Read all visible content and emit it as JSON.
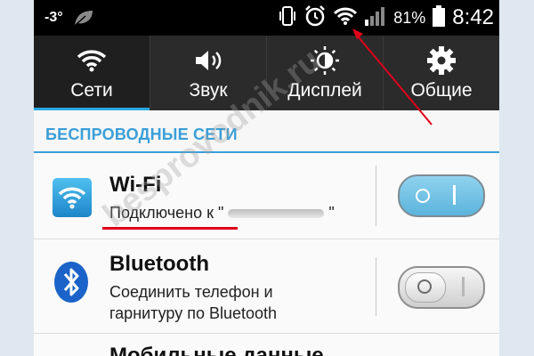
{
  "status_bar": {
    "signal": "-3°",
    "battery_percent": "81%",
    "time": "8:42",
    "icons": [
      "leaf-icon",
      "vibrate-icon",
      "alarm-icon",
      "wifi-icon",
      "signal-bars-icon",
      "battery-icon"
    ]
  },
  "tabs": [
    {
      "label": "Сети",
      "icon": "wifi-icon",
      "active": true
    },
    {
      "label": "Звук",
      "icon": "speaker-icon",
      "active": false
    },
    {
      "label": "Дисплей",
      "icon": "brightness-icon",
      "active": false
    },
    {
      "label": "Общие",
      "icon": "gear-icon",
      "active": false
    }
  ],
  "section": {
    "title": "БЕСПРОВОДНЫЕ СЕТИ"
  },
  "wifi": {
    "title": "Wi-Fi",
    "status": "Подключено к \"",
    "status_end": "\"",
    "enabled": true,
    "toggle_label": "I"
  },
  "bluetooth": {
    "title": "Bluetooth",
    "line1": "Соединить телефон и",
    "line2": "гарнитуру по Bluetooth",
    "enabled": false,
    "toggle_label": "O"
  },
  "mobile": {
    "title": "Мобильные данные"
  },
  "watermark": "besprovodnik.ru",
  "colors": {
    "accent": "#3a9fd8",
    "annotation": "#e0001a",
    "toolbar": "#2b2b2b"
  }
}
